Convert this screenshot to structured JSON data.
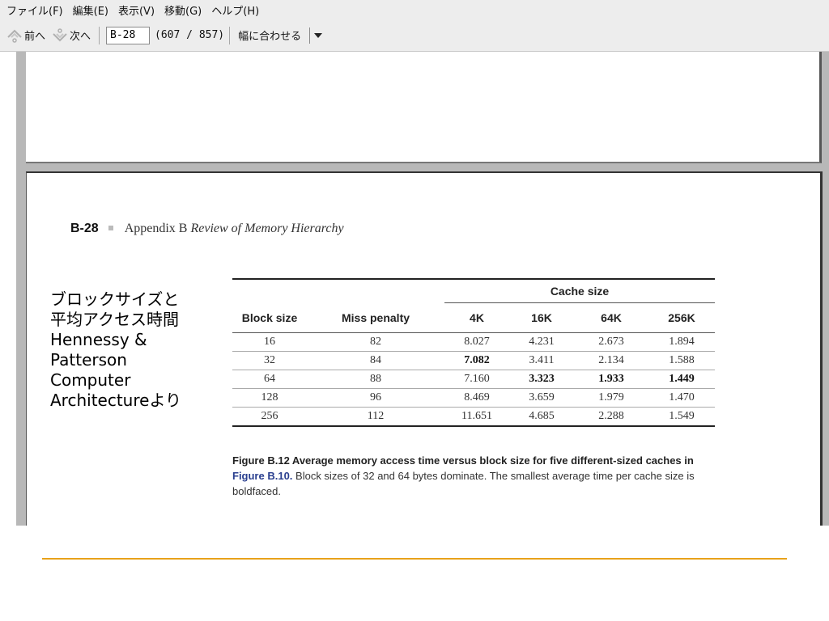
{
  "menubar": {
    "items": [
      "ファイル(F)",
      "編集(E)",
      "表示(V)",
      "移動(G)",
      "ヘルプ(H)"
    ]
  },
  "toolbar": {
    "prev_label": "前へ",
    "next_label": "次へ",
    "page_value": "B-28",
    "page_count": "(607 / 857)",
    "zoom_label": "幅に合わせる"
  },
  "page": {
    "number": "B-28",
    "appendix": "Appendix B",
    "title": "Review of Memory Hierarchy"
  },
  "table": {
    "group_header": "Cache size",
    "headers": [
      "Block size",
      "Miss penalty",
      "4K",
      "16K",
      "64K",
      "256K"
    ],
    "rows": [
      [
        "16",
        "82",
        "8.027",
        "4.231",
        "2.673",
        "1.894"
      ],
      [
        "32",
        "84",
        "7.082",
        "3.411",
        "2.134",
        "1.588"
      ],
      [
        "64",
        "88",
        "7.160",
        "3.323",
        "1.933",
        "1.449"
      ],
      [
        "128",
        "96",
        "8.469",
        "3.659",
        "1.979",
        "1.470"
      ],
      [
        "256",
        "112",
        "11.651",
        "4.685",
        "2.288",
        "1.549"
      ]
    ]
  },
  "caption": {
    "label": "Figure B.12  Average memory access time versus block size for five different-sized caches in ",
    "link": "Figure B.10.",
    "text": " Block sizes of 32 and 64 bytes dominate. The smallest average time per cache size is boldfaced."
  },
  "annotation": {
    "lines": [
      "ブロックサイズと",
      "平均アクセス時間",
      "Hennessy &",
      "Patterson",
      "Computer",
      "Architectureより"
    ]
  },
  "colors": {
    "accent_rule": "#e8a21a",
    "caption_link": "#2a3f8f"
  }
}
